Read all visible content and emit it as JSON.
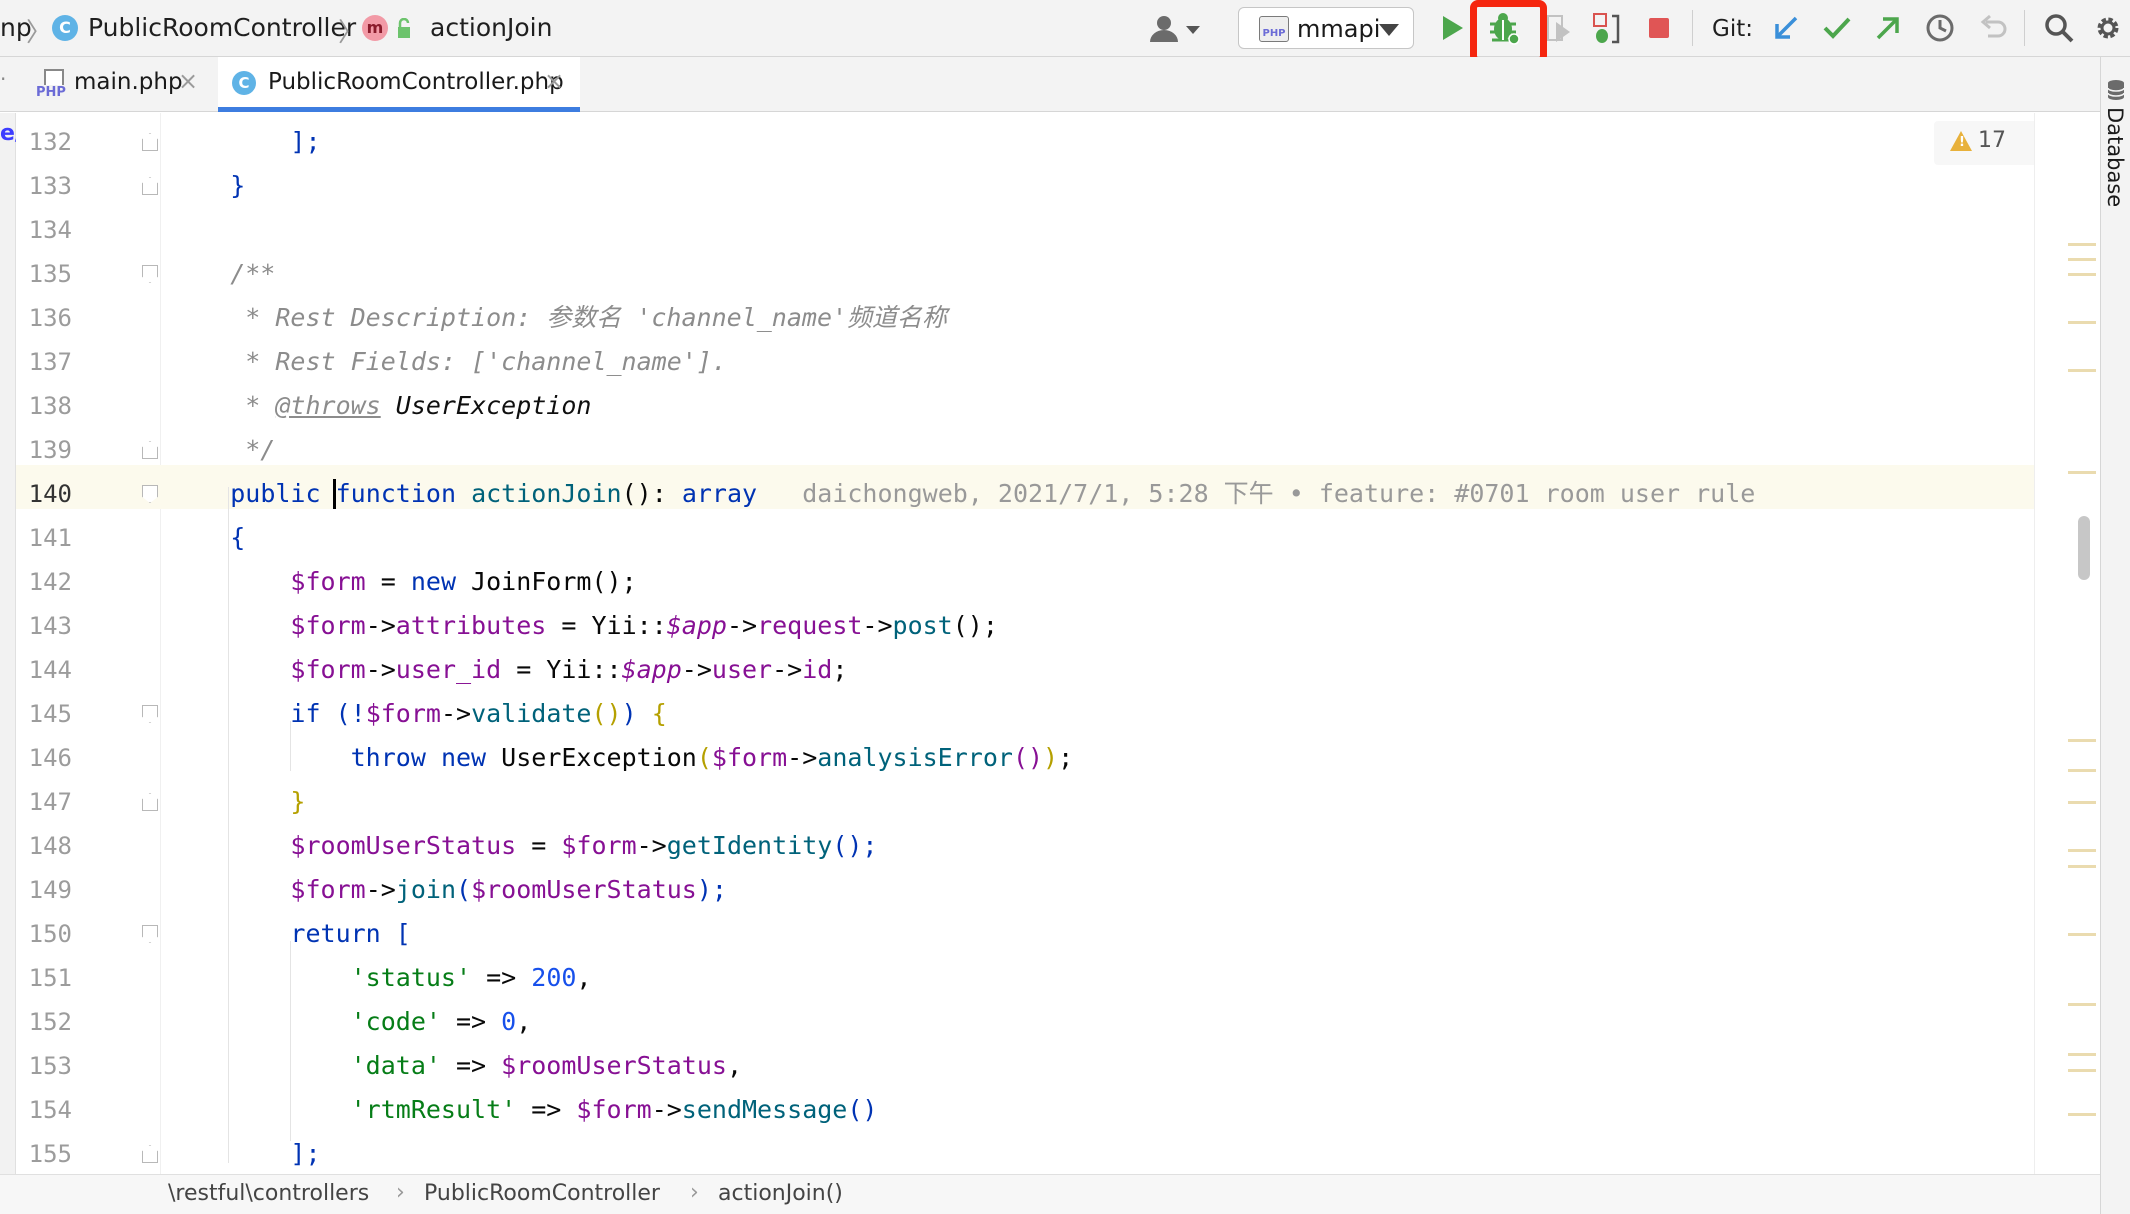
{
  "breadcrumb": {
    "root": "np",
    "class_name": "PublicRoomController",
    "class_icon_letter": "C",
    "method_icon_letter": "m",
    "method_name": "actionJoin"
  },
  "toolbar": {
    "run_config": "mmapi",
    "run_config_badge": "PHP",
    "git_label": "Git:",
    "highlighted_button": "debug"
  },
  "tabs": [
    {
      "label": "main.php",
      "icon": "php-file-icon",
      "active": false
    },
    {
      "label": "PublicRoomController.php",
      "icon": "class-icon",
      "icon_letter": "C",
      "active": true
    }
  ],
  "right_panel": {
    "label": "Database"
  },
  "inspections": {
    "warning_count": "17"
  },
  "editor": {
    "current_line": 140,
    "lines": [
      {
        "n": "132",
        "fold": "close"
      },
      {
        "n": "133",
        "fold": "close"
      },
      {
        "n": "134",
        "fold": ""
      },
      {
        "n": "135",
        "fold": "open"
      },
      {
        "n": "136",
        "fold": ""
      },
      {
        "n": "137",
        "fold": ""
      },
      {
        "n": "138",
        "fold": ""
      },
      {
        "n": "139",
        "fold": "close"
      },
      {
        "n": "140",
        "fold": "open"
      },
      {
        "n": "141",
        "fold": ""
      },
      {
        "n": "142",
        "fold": ""
      },
      {
        "n": "143",
        "fold": ""
      },
      {
        "n": "144",
        "fold": ""
      },
      {
        "n": "145",
        "fold": "open"
      },
      {
        "n": "146",
        "fold": ""
      },
      {
        "n": "147",
        "fold": "close"
      },
      {
        "n": "148",
        "fold": ""
      },
      {
        "n": "149",
        "fold": ""
      },
      {
        "n": "150",
        "fold": "open"
      },
      {
        "n": "151",
        "fold": ""
      },
      {
        "n": "152",
        "fold": ""
      },
      {
        "n": "153",
        "fold": ""
      },
      {
        "n": "154",
        "fold": ""
      },
      {
        "n": "155",
        "fold": "close"
      }
    ],
    "code": {
      "l132": {
        "a": "        ];"
      },
      "l133": {
        "a": "    }"
      },
      "l135": {
        "a": "    /**"
      },
      "l136": {
        "a": "     * Rest Description: 参数名 'channel_name'频道名称"
      },
      "l137": {
        "a": "     * Rest Fields: ['channel_name']."
      },
      "l138": {
        "a": "     * ",
        "tag": "@throws",
        "sp": " ",
        "type": "UserException"
      },
      "l139": {
        "a": "     */"
      },
      "l140": {
        "a": "    ",
        "public": "public",
        "sp1": " ",
        "function": "function",
        "sp2": " ",
        "name": "actionJoin",
        "sig": "(): ",
        "ret": "array",
        "blame": "   daichongweb, 2021/7/1, 5:28 下午 • feature: #0701 room user rule"
      },
      "l141": {
        "a": "    {"
      },
      "l142": {
        "ind": "        ",
        "v": "$form",
        "eq": " = ",
        "new": "new",
        "rest": " JoinForm();"
      },
      "l143": {
        "ind": "        ",
        "v": "$form",
        "arr": "->",
        "p": "attributes",
        "eq": " = Yii::",
        "app": "$app",
        "arr2": "->",
        "p2": "request",
        "arr3": "->",
        "m": "post",
        "end": "();"
      },
      "l144": {
        "ind": "        ",
        "v": "$form",
        "arr": "->",
        "p": "user_id",
        "eq": " = Yii::",
        "app": "$app",
        "arr2": "->",
        "p2": "user",
        "arr3": "->",
        "p3": "id",
        "end": ";"
      },
      "l145": {
        "ind": "        ",
        "if": "if",
        "o": " (!",
        "v": "$form",
        "arr": "->",
        "m": "validate",
        "pp": "()",
        "c": ") ",
        "b": "{"
      },
      "l146": {
        "ind": "            ",
        "throw": "throw",
        "sp": " ",
        "new": "new",
        "cls": " UserException",
        "o": "(",
        "v": "$form",
        "arr": "->",
        "m": "analysisError",
        "pp": "()",
        "c": ")",
        "end": ";"
      },
      "l147": {
        "ind": "        ",
        "b": "}"
      },
      "l148": {
        "ind": "        ",
        "v": "$roomUserStatus",
        "eq": " = ",
        "v2": "$form",
        "arr": "->",
        "m": "getIdentity",
        "end": "();"
      },
      "l149": {
        "ind": "        ",
        "v": "$form",
        "arr": "->",
        "m": "join",
        "o": "(",
        "v2": "$roomUserStatus",
        "end": ");"
      },
      "l150": {
        "ind": "        ",
        "ret": "return",
        "sp": " ",
        "b": "["
      },
      "l151": {
        "ind": "            ",
        "k": "'status'",
        "op": " => ",
        "num": "200",
        "end": ","
      },
      "l152": {
        "ind": "            ",
        "k": "'code'",
        "op": " => ",
        "num": "0",
        "end": ","
      },
      "l153": {
        "ind": "            ",
        "k": "'data'",
        "op": " => ",
        "v": "$roomUserStatus",
        "end": ","
      },
      "l154": {
        "ind": "            ",
        "k": "'rtmResult'",
        "op": " => ",
        "v": "$form",
        "arr": "->",
        "m": "sendMessage",
        "end": "()"
      },
      "l155": {
        "ind": "        ",
        "b": "];"
      }
    }
  },
  "bottom_breadcrumb": {
    "namespace": "\\restful\\controllers",
    "class_name": "PublicRoomController",
    "method": "actionJoin()"
  },
  "colors": {
    "keyword": "#0033b3",
    "variable": "#871094",
    "method": "#00627a",
    "string": "#067d17",
    "number": "#1750eb",
    "comment": "#8c8c8c",
    "highlight_box": "#f5260f",
    "current_line_bg": "#fcfaed"
  }
}
